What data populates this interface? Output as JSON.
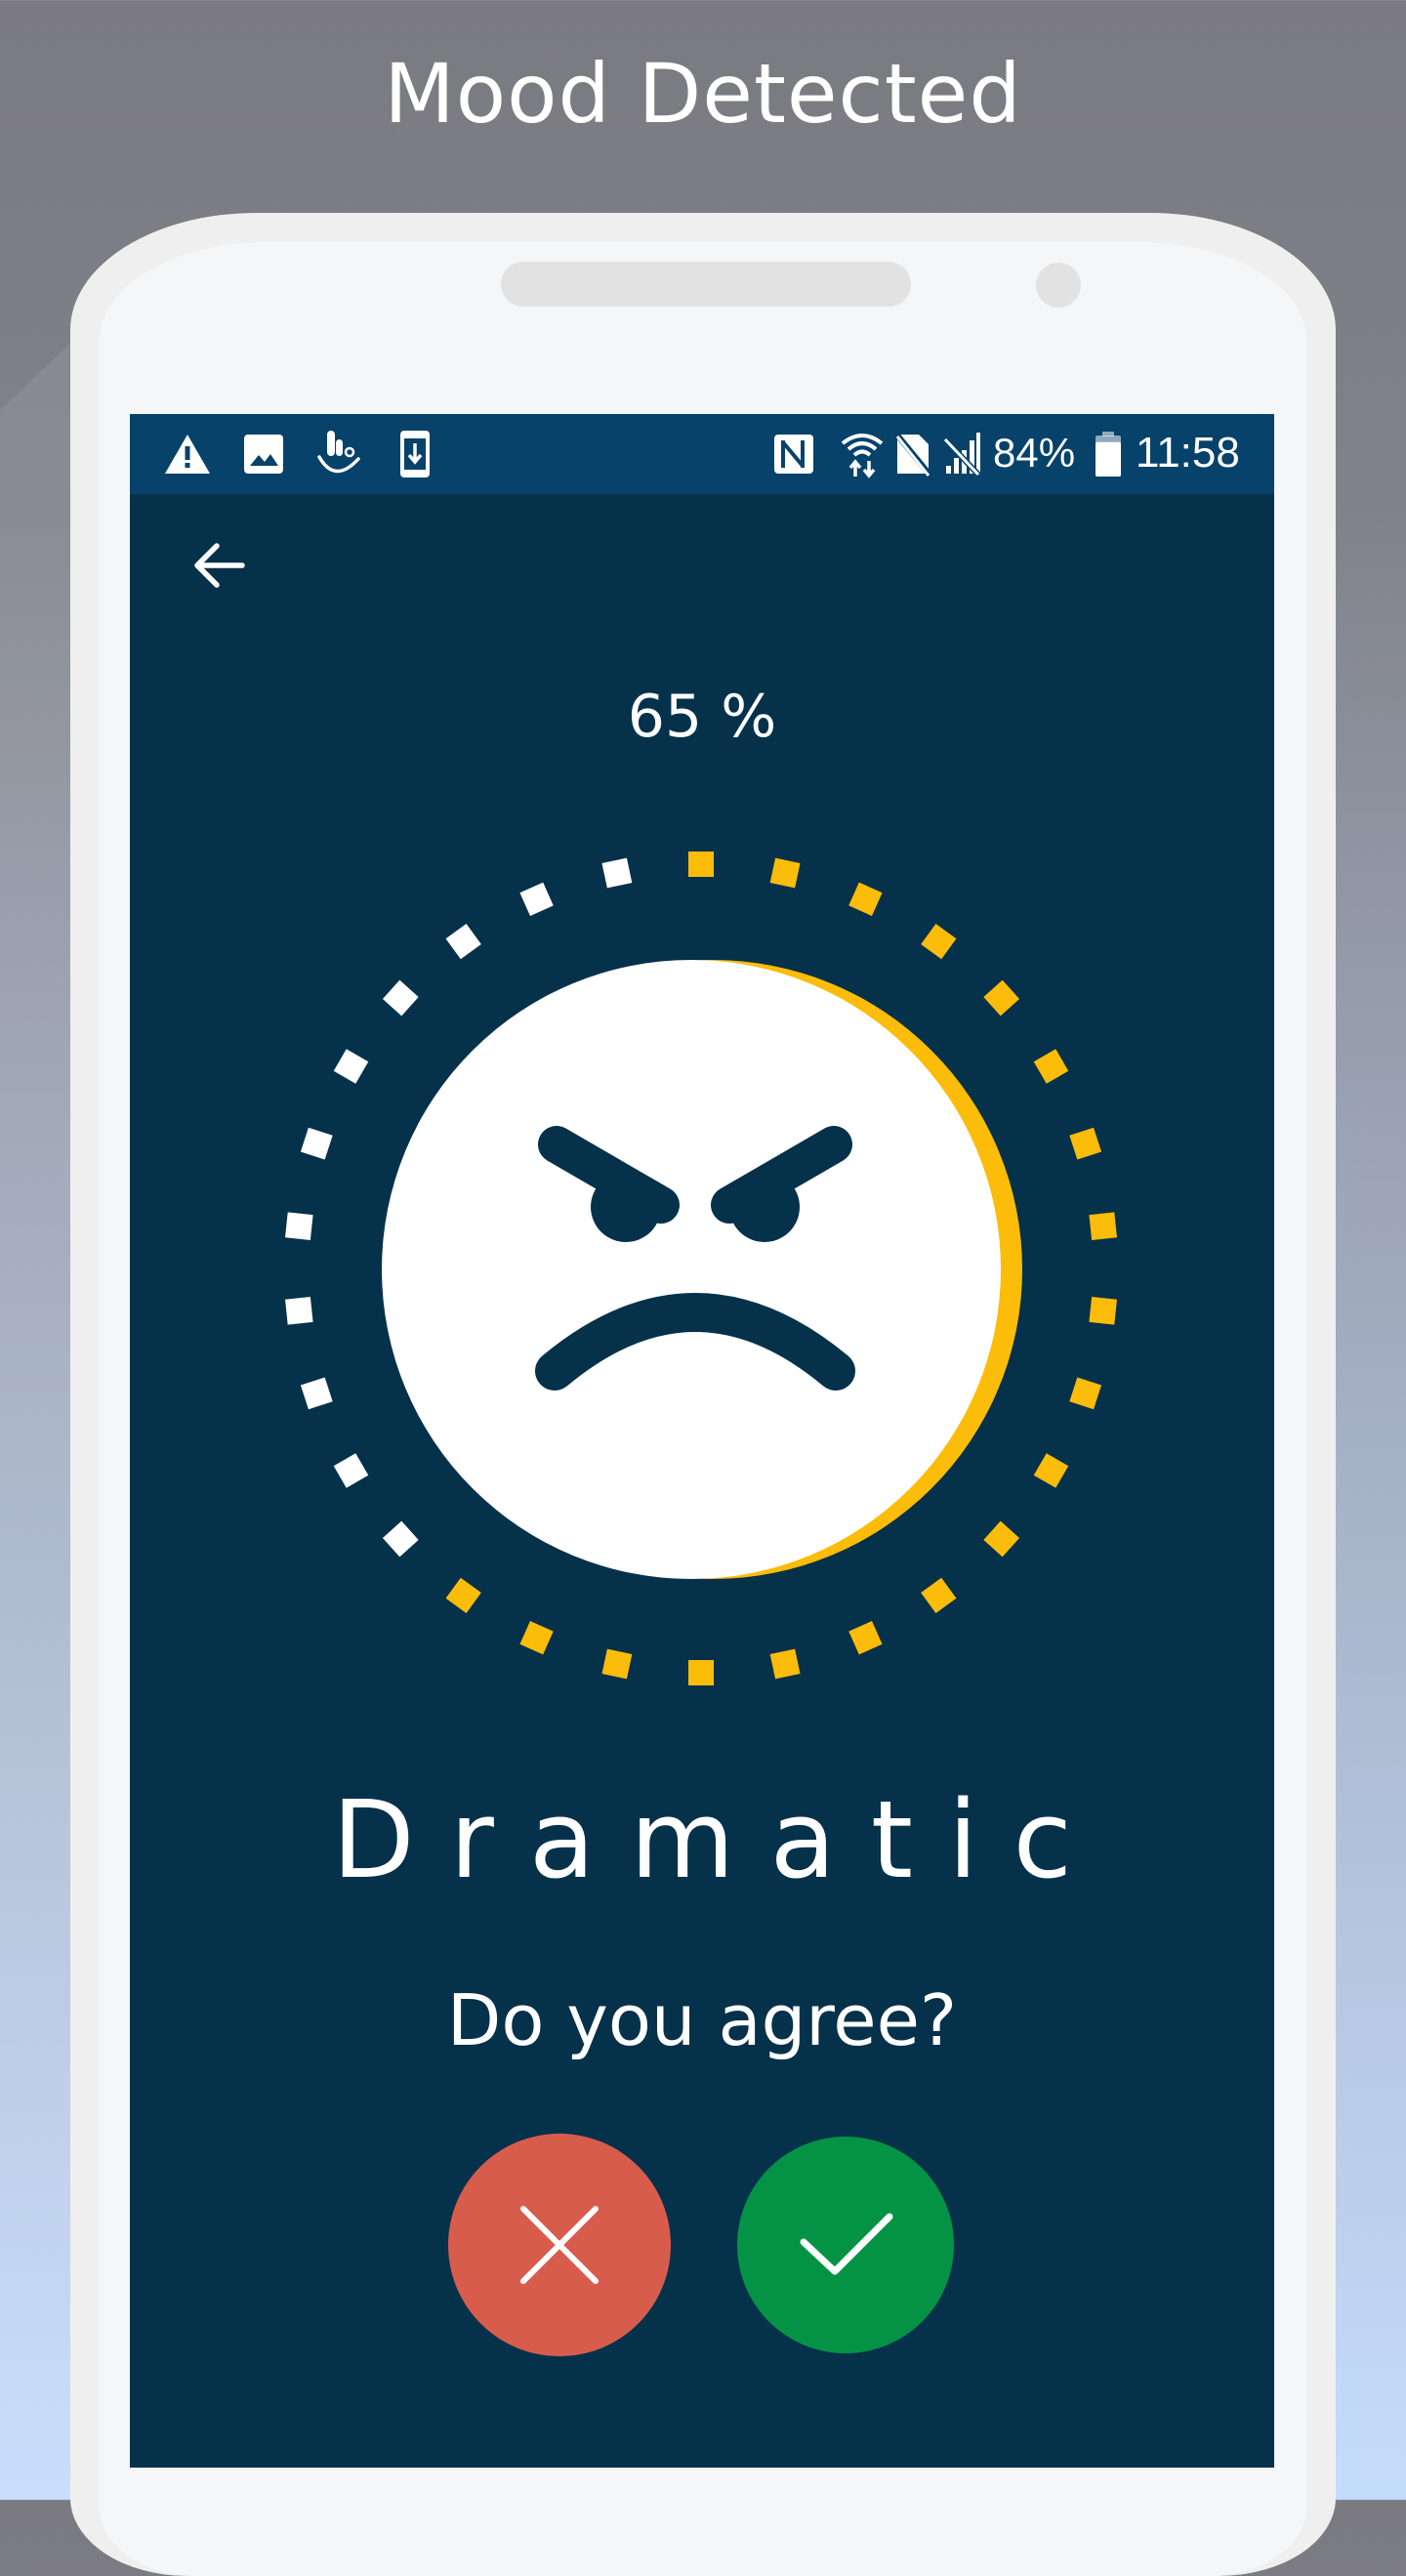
{
  "promo": {
    "title": "Mood Detected"
  },
  "status_bar": {
    "left_icons": [
      "warning-icon",
      "image-icon",
      "touchpal-keyboard-icon",
      "download-to-phone-icon"
    ],
    "right_icons": [
      "nfc-icon",
      "wifi-data-icon",
      "no-sim-icon",
      "no-signal-icon"
    ],
    "battery_percent": "84%",
    "battery_level": 0.84,
    "time": "11:58"
  },
  "toolbar": {
    "back_icon": "arrow-left-icon"
  },
  "result": {
    "confidence_label": "65 %",
    "confidence_value": 65,
    "dial": {
      "total_ticks": 30,
      "filled_ticks": 19,
      "filled_color": "#fbbc0a",
      "empty_color": "#ffffff"
    },
    "face_icon": "angry-face-icon",
    "mood": "Dramatic",
    "question": "Do you agree?"
  },
  "actions": {
    "disagree": {
      "icon": "close-icon",
      "label": "Disagree",
      "color": "#d85c4c"
    },
    "agree": {
      "icon": "check-icon",
      "label": "Agree",
      "color": "#049345"
    }
  },
  "colors": {
    "status_bar_bg": "#07426a",
    "screen_bg": "#05314b",
    "accent": "#fbbc0a"
  }
}
